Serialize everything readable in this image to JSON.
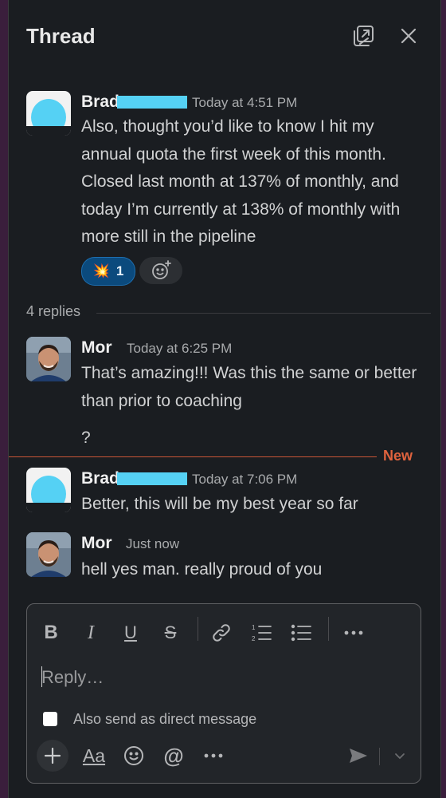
{
  "header": {
    "title": "Thread"
  },
  "messages": [
    {
      "author": "Brad",
      "time": "Today at 4:51 PM",
      "text": "Also, thought you’d like to know I hit my annual quota the first week of this month. Closed last month at 137% of monthly, and today I’m currently at 138% of monthly with more still in the pipeline",
      "reaction": {
        "emoji": "💥",
        "count": "1"
      }
    },
    {
      "author": "Mor",
      "time": "Today at 6:25 PM",
      "text": "That’s amazing!!! Was this the same or better than prior to coaching",
      "text2": "?"
    },
    {
      "author": "Brad",
      "time": "Today at 7:06 PM",
      "text": "Better, this will be my best year so far"
    },
    {
      "author": "Mor",
      "time": "Just now",
      "text": "hell yes man. really proud of you"
    }
  ],
  "replies_label": "4 replies",
  "new_label": "New",
  "composer": {
    "placeholder": "Reply…",
    "also_send_label": "Also send as direct message",
    "format_label": "Aa"
  },
  "colors": {
    "panel_bg": "#1a1d21",
    "window_bg": "#3a1e3c",
    "new_accent": "#e0633e",
    "reaction_bg": "#0b4a7d",
    "redaction": "#55d1f4"
  }
}
